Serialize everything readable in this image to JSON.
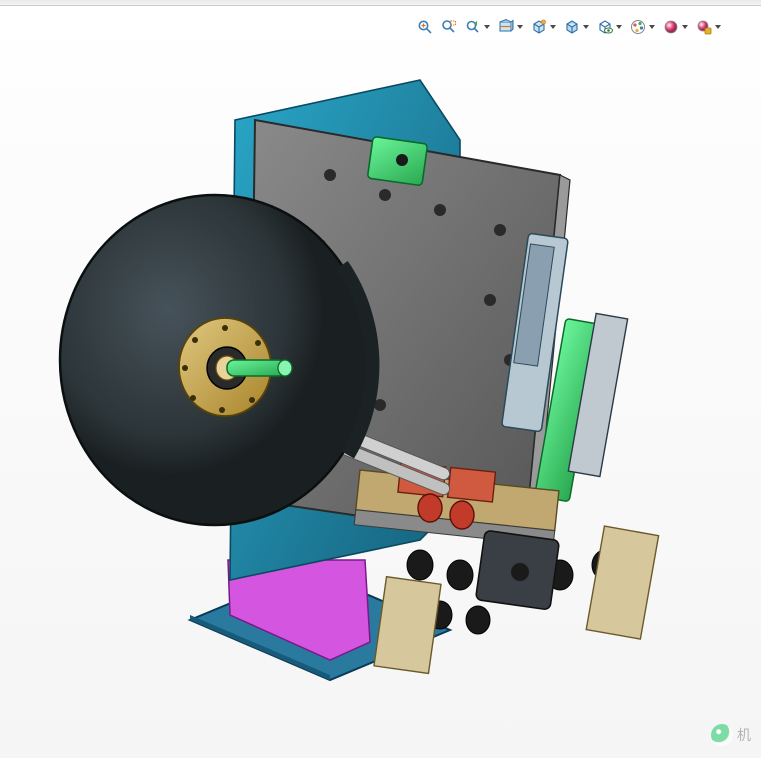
{
  "toolbar": {
    "zoom_to_fit": "Zoom to Fit",
    "zoom_to_area": "Zoom to Area",
    "previous_view": "Previous View",
    "section_view": "Section View",
    "view_orientation": "View Orientation",
    "display_style": "Display Style",
    "hide_show": "Hide/Show Items",
    "edit_appearance": "Edit Appearance",
    "apply_scene": "Apply Scene",
    "view_settings": "View Settings"
  },
  "watermark": {
    "text": "机"
  },
  "model": {
    "description": "Labeling / winding machine assembly",
    "main_disc_color": "#2c3538",
    "plate_color": "#6a6a6a",
    "accent_colors": [
      "#3fe07a",
      "#2aa6c8",
      "#d05a3f",
      "#c7a24b",
      "#d455e0"
    ]
  }
}
